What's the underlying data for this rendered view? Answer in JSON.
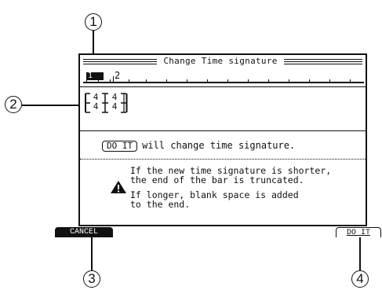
{
  "callouts": [
    "1",
    "2",
    "3",
    "4"
  ],
  "window": {
    "title": "Change Time signature",
    "bars": [
      "1",
      "2"
    ],
    "selected_bar": "1",
    "time_signature": {
      "old": {
        "numerator": "4",
        "denominator": "4"
      },
      "new": {
        "numerator": "4",
        "denominator": "4"
      }
    },
    "doit_key": "DO IT",
    "doit_text": "will change time signature.",
    "messages": [
      "If the new time signature is shorter,",
      "the end of the bar is truncated.",
      "If longer, blank space is added",
      "to the end."
    ],
    "warning_icon": "warning-triangle-icon"
  },
  "buttons": {
    "cancel": "CANCEL",
    "doit": "DO IT"
  }
}
